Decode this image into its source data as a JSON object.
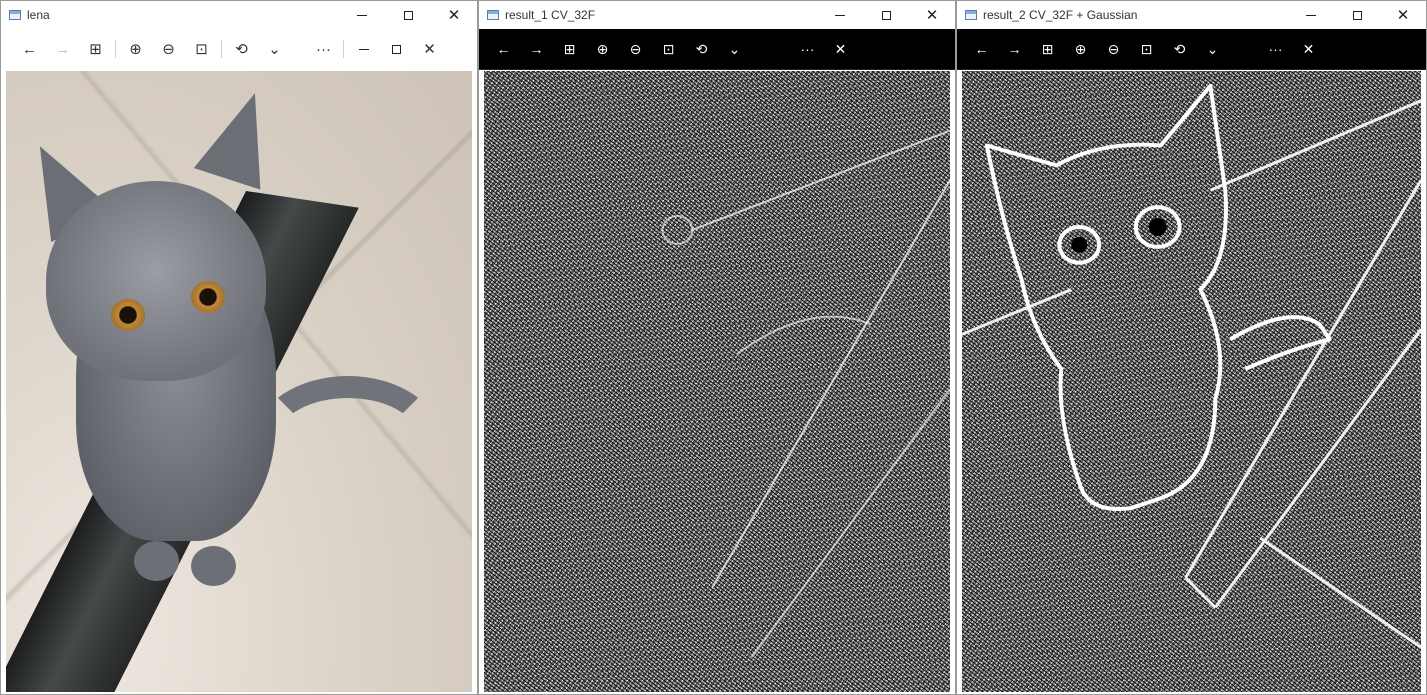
{
  "windows": [
    {
      "title": "lena",
      "toolbar": {
        "back_icon": "←",
        "forward_icon": "→",
        "grid_icon": "⊞",
        "zoom_in_icon": "⊕",
        "zoom_out_icon": "⊖",
        "fit_icon": "⊡",
        "rotate_icon": "⟲",
        "dropdown_icon": "⌄",
        "more_icon": "···"
      }
    },
    {
      "title": "result_1 CV_32F"
    },
    {
      "title": "result_2 CV_32F + Gaussian"
    }
  ],
  "caption_buttons": {
    "close_symbol": "✕"
  },
  "colors": {
    "floor": "#d9d0c6",
    "cat_gray": "#6f7278",
    "cat_eye": "#c08a3a",
    "edge_black": "#000000",
    "edge_white": "#ffffff"
  }
}
